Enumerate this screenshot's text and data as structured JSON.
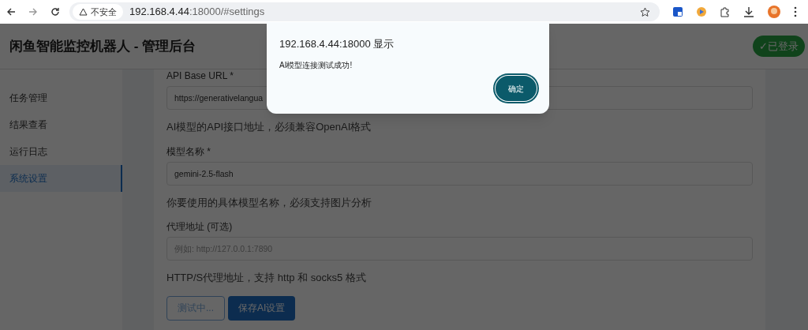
{
  "browser": {
    "security_label": "不安全",
    "url_host": "192.168.4.44",
    "url_rest": ":18000/#settings"
  },
  "header": {
    "title": "闲鱼智能监控机器人 - 管理后台",
    "status_badge": "✓已登录"
  },
  "sidebar": {
    "items": [
      {
        "label": "任务管理",
        "selected": false
      },
      {
        "label": "结果查看",
        "selected": false
      },
      {
        "label": "运行日志",
        "selected": false
      },
      {
        "label": "系统设置",
        "selected": true
      }
    ]
  },
  "form": {
    "fields": [
      {
        "label": "API Base URL *",
        "value": "https://generativelangua",
        "help": "AI模型的API接口地址，必须兼容OpenAI格式"
      },
      {
        "label": "模型名称 *",
        "value": "gemini-2.5-flash",
        "help": "你要使用的具体模型名称，必须支持图片分析"
      },
      {
        "label": "代理地址 (可选)",
        "placeholder": "例如: http://127.0.0.1:7890",
        "help": "HTTP/S代理地址，支持 http 和 socks5 格式"
      }
    ],
    "buttons": [
      {
        "label": "测试中...",
        "kind": "outline",
        "disabled": true
      },
      {
        "label": "保存AI设置",
        "kind": "primary",
        "disabled": false
      }
    ]
  },
  "dialog": {
    "title": "192.168.4.44:18000 显示",
    "message": "AI模型连接测试成功!",
    "button": "确定"
  }
}
